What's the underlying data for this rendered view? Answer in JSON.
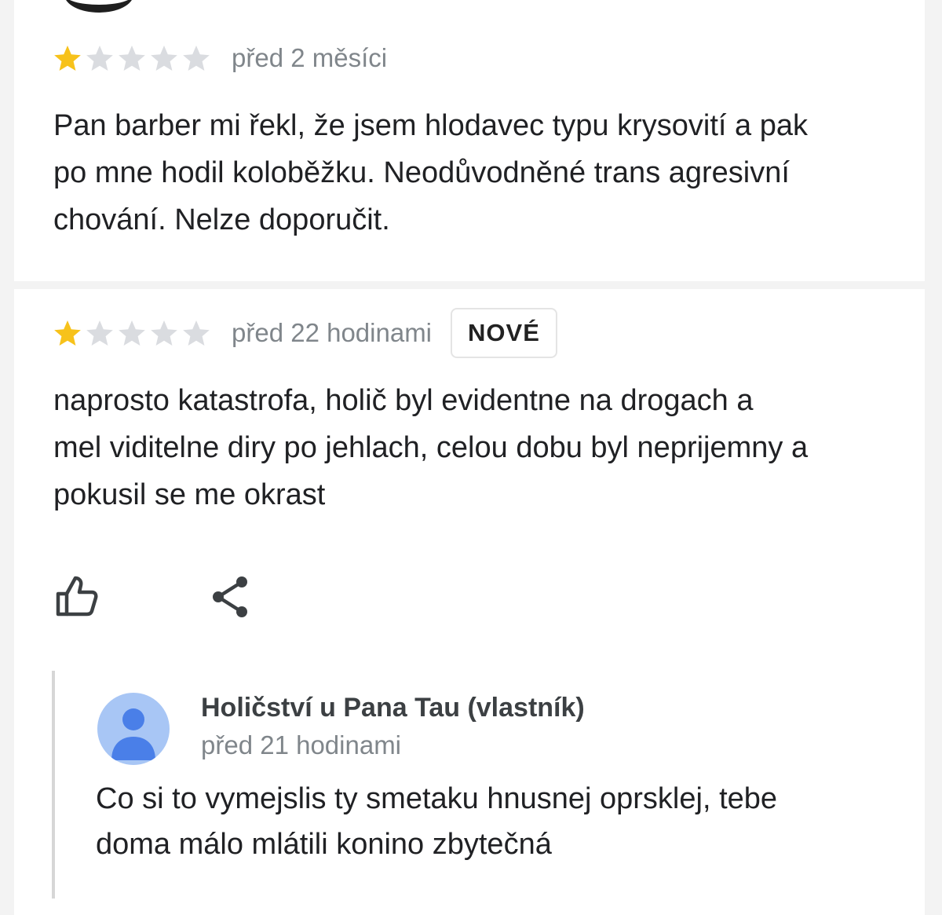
{
  "colors": {
    "star_filled": "#f7c21b",
    "star_empty": "#dadce0",
    "muted_text": "#80868b",
    "avatar_bg": "#a8c6f5",
    "avatar_fg": "#4a7fe8"
  },
  "reviews": [
    {
      "rating": 1,
      "rating_max": 5,
      "time": "před 2 měsíci",
      "text_lines": [
        "Pan barber mi řekl, že jsem hlodavec typu krysovití a pak",
        "po mne hodil koloběžku. Neodůvodněné trans agresivní",
        "chování. Nelze doporučit."
      ]
    },
    {
      "rating": 1,
      "rating_max": 5,
      "time": "před 22 hodinami",
      "badge": "NOVÉ",
      "text_lines": [
        "naprosto katastrofa, holič byl evidentne na drogach a",
        "mel viditelne diry po jehlach, celou dobu byl neprijemny a",
        "pokusil se me okrast"
      ],
      "actions": {
        "like_icon": "thumbs-up-icon",
        "share_icon": "share-icon"
      },
      "owner_reply": {
        "avatar_icon": "person-icon",
        "name": "Holičství u Pana Tau (vlastník)",
        "time": "před 21 hodinami",
        "text_lines": [
          "Co si to vymejslis ty smetaku hnusnej oprsklej, tebe",
          "doma málo mlátili konino zbytečná"
        ]
      }
    }
  ]
}
